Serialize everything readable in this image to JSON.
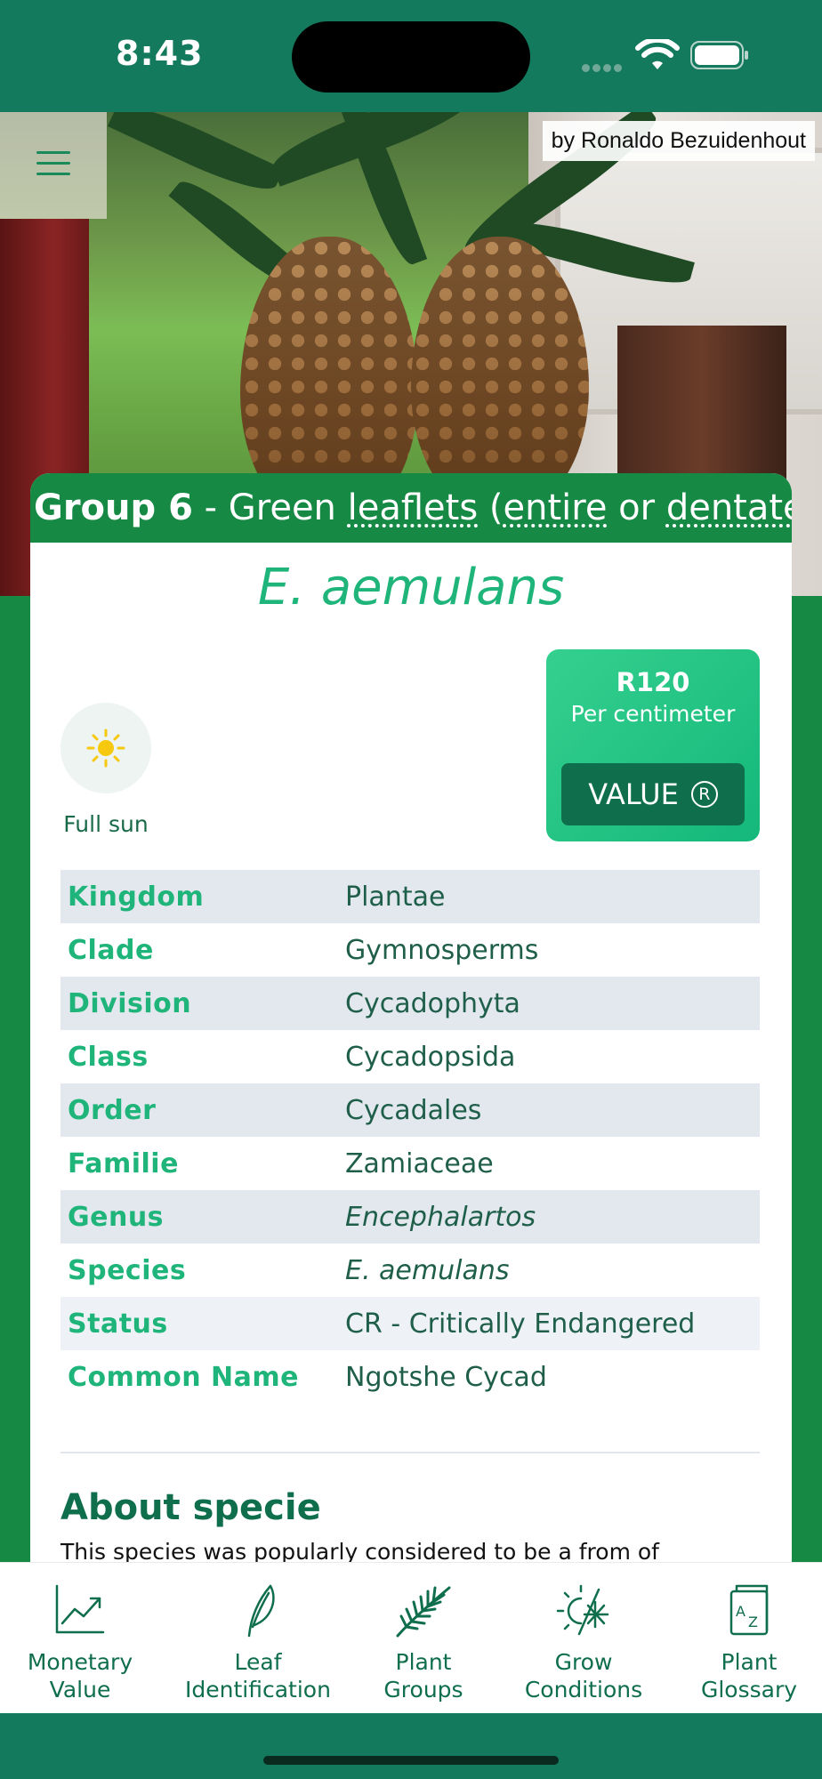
{
  "status_bar": {
    "time": "8:43"
  },
  "hero": {
    "photo_credit": "by Ronaldo Bezuidenhout"
  },
  "card": {
    "group_label": "Group 6",
    "group_sep": " - Green ",
    "group_word_leaflets": "leaflets",
    "group_open": " (",
    "group_word_entire": "entire",
    "group_or": " or ",
    "group_word_dentate": "dentate",
    "group_close": ")",
    "species_title": "E. aemulans",
    "conditions": {
      "sun_label": "Full sun"
    },
    "value": {
      "price": "R120",
      "unit": "Per centimeter",
      "button_label": "VALUE",
      "button_symbol": "R"
    },
    "taxonomy": [
      {
        "key": "Kingdom",
        "value": "Plantae"
      },
      {
        "key": "Clade",
        "value": "Gymnosperms"
      },
      {
        "key": "Division",
        "value": "Cycadophyta"
      },
      {
        "key": "Class",
        "value": "Cycadopsida"
      },
      {
        "key": "Order",
        "value": "Cycadales"
      },
      {
        "key": "Familie",
        "value": "Zamiaceae"
      },
      {
        "key": "Genus",
        "value": "Encephalartos"
      },
      {
        "key": "Species",
        "value": "E. aemulans"
      },
      {
        "key": "Status",
        "value": "CR - Critically Endangered"
      },
      {
        "key": "Common Name",
        "value": "Ngotshe Cycad"
      }
    ],
    "about": {
      "title": "About specie",
      "text": "This species was popularly considered to be a from of"
    }
  },
  "bottom_nav": [
    {
      "line1": "Monetary",
      "line2": "Value",
      "icon": "chart-trend-icon"
    },
    {
      "line1": "Leaf",
      "line2": "Identification",
      "icon": "leaf-icon"
    },
    {
      "line1": "Plant",
      "line2": "Groups",
      "icon": "frond-icon"
    },
    {
      "line1": "Grow",
      "line2": "Conditions",
      "icon": "sun-snow-icon"
    },
    {
      "line1": "Plant",
      "line2": "Glossary",
      "icon": "glossary-book-icon"
    }
  ],
  "colors": {
    "brand_green": "#168a44",
    "accent_green": "#1fb57a",
    "dark_green": "#0f6e4c",
    "status_bar": "#147a5e"
  }
}
